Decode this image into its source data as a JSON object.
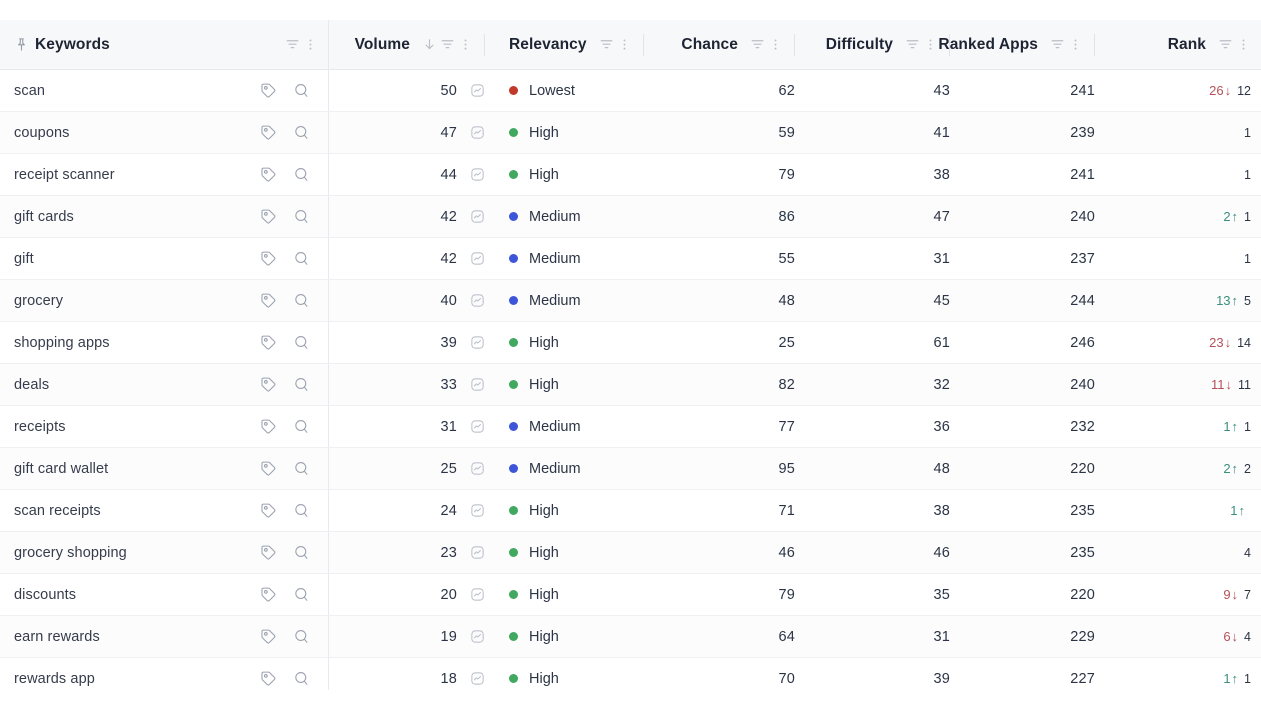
{
  "table": {
    "columns": [
      {
        "key": "keywords",
        "label": "Keywords",
        "align": "left",
        "pinned": true,
        "sort": "none",
        "has_filter": true,
        "has_menu": true
      },
      {
        "key": "volume",
        "label": "Volume",
        "align": "right",
        "pinned": false,
        "sort": "desc",
        "has_filter": true,
        "has_menu": true
      },
      {
        "key": "relevancy",
        "label": "Relevancy",
        "align": "left",
        "pinned": false,
        "sort": "none",
        "has_filter": true,
        "has_menu": true
      },
      {
        "key": "chance",
        "label": "Chance",
        "align": "right",
        "pinned": false,
        "sort": "none",
        "has_filter": true,
        "has_menu": true
      },
      {
        "key": "difficulty",
        "label": "Difficulty",
        "align": "right",
        "pinned": false,
        "sort": "none",
        "has_filter": true,
        "has_menu": true
      },
      {
        "key": "ranked_apps",
        "label": "Ranked Apps",
        "align": "right",
        "pinned": false,
        "sort": "none",
        "has_filter": true,
        "has_menu": true
      },
      {
        "key": "rank",
        "label": "Rank",
        "align": "right",
        "pinned": false,
        "sort": "none",
        "has_filter": true,
        "has_menu": true
      }
    ],
    "icons": {
      "pin": "pin-icon",
      "filter": "filter-icon",
      "menu": "more-vertical-icon",
      "sort_desc": "arrow-down-icon",
      "tag": "tag-icon",
      "search": "search-icon",
      "trend": "trend-chart-icon"
    },
    "relevancy_colors": {
      "Lowest": "#c0392b",
      "High": "#41a85f",
      "Medium": "#3d55d8"
    },
    "rank_colors": {
      "up": "#3a8f7e",
      "down": "#b5505a"
    },
    "rows": [
      {
        "keyword": "scan",
        "volume": "50",
        "relevancy": "Lowest",
        "chance": "62",
        "difficulty": "43",
        "ranked_apps": "241",
        "rank_delta": "26",
        "rank_dir": "down",
        "rank": "12"
      },
      {
        "keyword": "coupons",
        "volume": "47",
        "relevancy": "High",
        "chance": "59",
        "difficulty": "41",
        "ranked_apps": "239",
        "rank_delta": "",
        "rank_dir": "none",
        "rank": "1"
      },
      {
        "keyword": "receipt scanner",
        "volume": "44",
        "relevancy": "High",
        "chance": "79",
        "difficulty": "38",
        "ranked_apps": "241",
        "rank_delta": "",
        "rank_dir": "none",
        "rank": "1"
      },
      {
        "keyword": "gift cards",
        "volume": "42",
        "relevancy": "Medium",
        "chance": "86",
        "difficulty": "47",
        "ranked_apps": "240",
        "rank_delta": "2",
        "rank_dir": "up",
        "rank": "1"
      },
      {
        "keyword": "gift",
        "volume": "42",
        "relevancy": "Medium",
        "chance": "55",
        "difficulty": "31",
        "ranked_apps": "237",
        "rank_delta": "",
        "rank_dir": "none",
        "rank": "1"
      },
      {
        "keyword": "grocery",
        "volume": "40",
        "relevancy": "Medium",
        "chance": "48",
        "difficulty": "45",
        "ranked_apps": "244",
        "rank_delta": "13",
        "rank_dir": "up",
        "rank": "5"
      },
      {
        "keyword": "shopping apps",
        "volume": "39",
        "relevancy": "High",
        "chance": "25",
        "difficulty": "61",
        "ranked_apps": "246",
        "rank_delta": "23",
        "rank_dir": "down",
        "rank": "14"
      },
      {
        "keyword": "deals",
        "volume": "33",
        "relevancy": "High",
        "chance": "82",
        "difficulty": "32",
        "ranked_apps": "240",
        "rank_delta": "11",
        "rank_dir": "down",
        "rank": "11"
      },
      {
        "keyword": "receipts",
        "volume": "31",
        "relevancy": "Medium",
        "chance": "77",
        "difficulty": "36",
        "ranked_apps": "232",
        "rank_delta": "1",
        "rank_dir": "up",
        "rank": "1"
      },
      {
        "keyword": "gift card wallet",
        "volume": "25",
        "relevancy": "Medium",
        "chance": "95",
        "difficulty": "48",
        "ranked_apps": "220",
        "rank_delta": "2",
        "rank_dir": "up",
        "rank": "2"
      },
      {
        "keyword": "scan receipts",
        "volume": "24",
        "relevancy": "High",
        "chance": "71",
        "difficulty": "38",
        "ranked_apps": "235",
        "rank_delta": "1",
        "rank_dir": "up",
        "rank": ""
      },
      {
        "keyword": "grocery shopping",
        "volume": "23",
        "relevancy": "High",
        "chance": "46",
        "difficulty": "46",
        "ranked_apps": "235",
        "rank_delta": "",
        "rank_dir": "none",
        "rank": "4"
      },
      {
        "keyword": "discounts",
        "volume": "20",
        "relevancy": "High",
        "chance": "79",
        "difficulty": "35",
        "ranked_apps": "220",
        "rank_delta": "9",
        "rank_dir": "down",
        "rank": "7"
      },
      {
        "keyword": "earn rewards",
        "volume": "19",
        "relevancy": "High",
        "chance": "64",
        "difficulty": "31",
        "ranked_apps": "229",
        "rank_delta": "6",
        "rank_dir": "down",
        "rank": "4"
      },
      {
        "keyword": "rewards app",
        "volume": "18",
        "relevancy": "High",
        "chance": "70",
        "difficulty": "39",
        "ranked_apps": "227",
        "rank_delta": "1",
        "rank_dir": "up",
        "rank": "1"
      }
    ]
  }
}
